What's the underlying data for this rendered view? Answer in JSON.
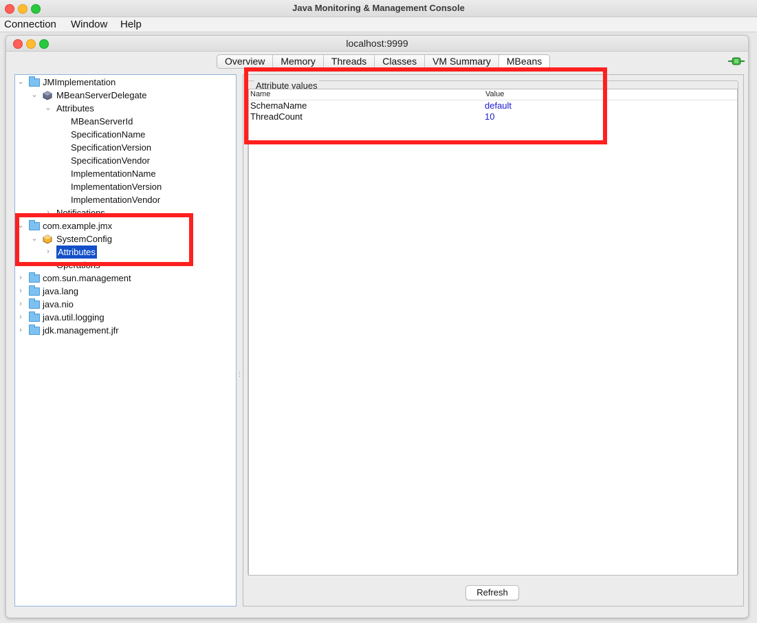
{
  "window": {
    "title": "Java Monitoring & Management Console"
  },
  "menu": [
    "Connection",
    "Window",
    "Help"
  ],
  "inner_window": {
    "title": "localhost:9999"
  },
  "tabs": [
    {
      "label": "Overview",
      "active": false
    },
    {
      "label": "Memory",
      "active": false
    },
    {
      "label": "Threads",
      "active": false
    },
    {
      "label": "Classes",
      "active": false
    },
    {
      "label": "VM Summary",
      "active": false
    },
    {
      "label": "MBeans",
      "active": true
    }
  ],
  "tree": {
    "jmimpl": "JMImplementation",
    "delegate": "MBeanServerDelegate",
    "attributes": "Attributes",
    "attr_items": [
      "MBeanServerId",
      "SpecificationName",
      "SpecificationVersion",
      "SpecificationVendor",
      "ImplementationName",
      "ImplementationVersion",
      "ImplementationVendor"
    ],
    "notifications": "Notifications",
    "example": "com.example.jmx",
    "sysconfig": "SystemConfig",
    "sys_attributes": "Attributes",
    "operations": "Operations",
    "domains": [
      "com.sun.management",
      "java.lang",
      "java.nio",
      "java.util.logging",
      "jdk.management.jfr"
    ]
  },
  "attribute_values": {
    "title": "Attribute values",
    "columns": [
      "Name",
      "Value"
    ],
    "rows": [
      {
        "name": "SchemaName",
        "value": "default"
      },
      {
        "name": "ThreadCount",
        "value": "10"
      }
    ]
  },
  "refresh_label": "Refresh",
  "colors": {
    "selection": "#1350c8",
    "value_text": "#1a1acc",
    "highlight": "#ff1f1f"
  }
}
